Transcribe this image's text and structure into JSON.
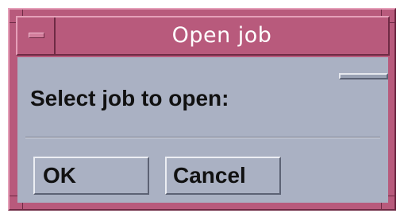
{
  "window": {
    "title": "Open job",
    "colors": {
      "frame": "#b85a7c",
      "content": "#aab1c3",
      "title_text": "#ffffff"
    }
  },
  "dialog": {
    "prompt": "Select job to open:",
    "buttons": {
      "ok_label": "OK",
      "cancel_label": "Cancel"
    }
  },
  "icons": {
    "window_menu": "window-menu-icon"
  }
}
